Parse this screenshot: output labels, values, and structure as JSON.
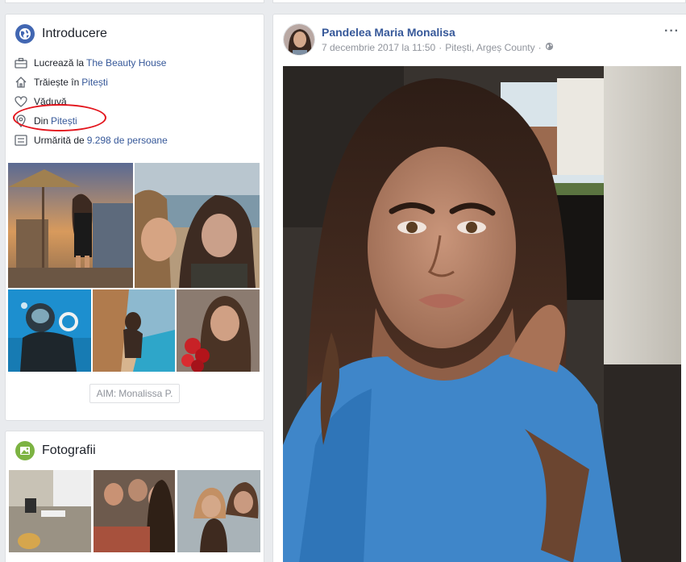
{
  "intro": {
    "title": "Introducere",
    "items": [
      {
        "icon": "briefcase-icon",
        "text": "Lucrează la",
        "link": "The Beauty House"
      },
      {
        "icon": "home-icon",
        "text": "Trăiește în",
        "link": "Pitești"
      },
      {
        "icon": "heart-icon",
        "text": "Văduvă",
        "link": ""
      },
      {
        "icon": "location-pin-icon",
        "text": "Din",
        "link": "Pitești"
      },
      {
        "icon": "followers-icon",
        "text": "Urmărită de",
        "link": "9.298 de persoane"
      }
    ],
    "aim_label": "AIM:",
    "aim_value": "Monalissa P."
  },
  "photos": {
    "title": "Fotografii"
  },
  "post": {
    "author": "Pandelea Maria Monalisa",
    "date": "7 decembrie 2017 la 11:50",
    "separator": "·",
    "location": "Pitești, Argeș County",
    "privacy_icon": "globe-icon",
    "more_label": "···"
  },
  "colors": {
    "link": "#365899",
    "background": "#e9ebee",
    "annotation": "#e3141c",
    "intro_icon": "#4267b2",
    "photos_icon": "#7cb342"
  }
}
